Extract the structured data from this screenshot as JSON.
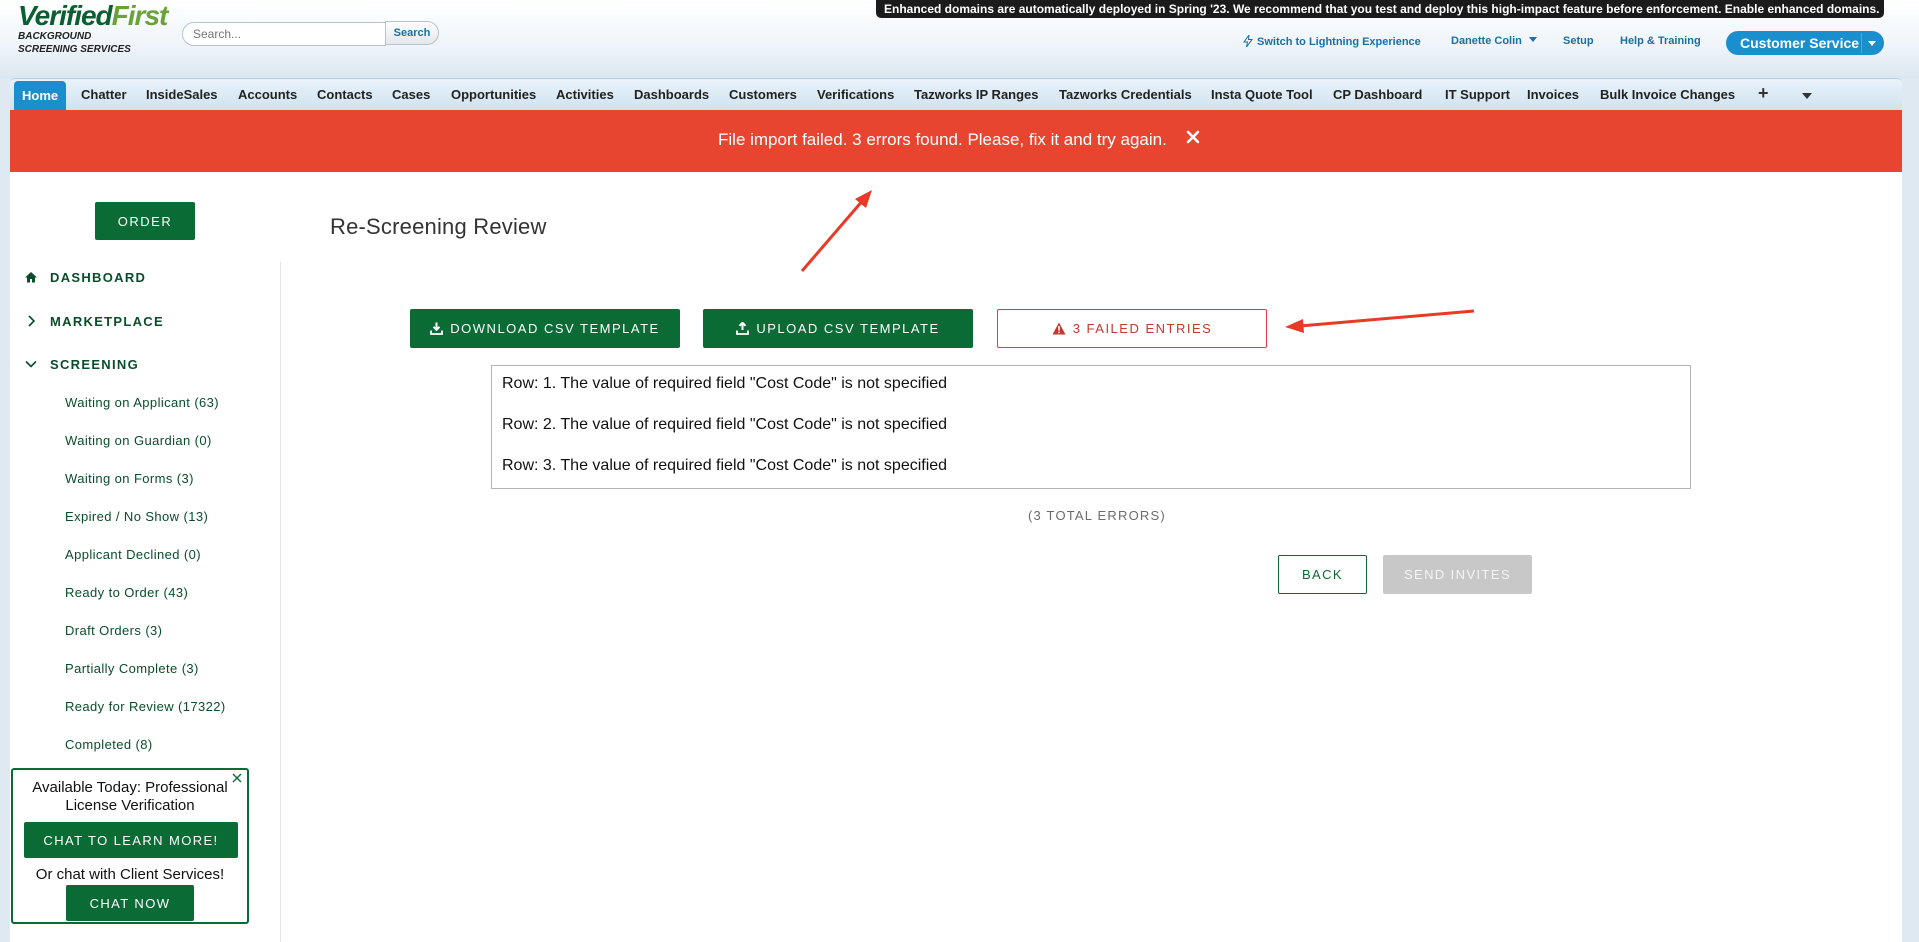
{
  "header": {
    "logo": {
      "line1a": "Verified",
      "line1b": "First",
      "line2": "BACKGROUND",
      "line3": "SCREENING SERVICES"
    },
    "search": {
      "placeholder": "Search...",
      "button": "Search"
    },
    "announcement": "Enhanced domains are automatically deployed in Spring '23. We recommend that you test and deploy this high-impact feature before enforcement. Enable enhanced domains.",
    "links": {
      "lightning": "Switch to Lightning Experience",
      "user": "Danette Colin",
      "setup": "Setup",
      "help": "Help & Training"
    },
    "app_switcher": "Customer Service"
  },
  "tabs": [
    "Home",
    "Chatter",
    "InsideSales",
    "Accounts",
    "Contacts",
    "Cases",
    "Opportunities",
    "Activities",
    "Dashboards",
    "Customers",
    "Verifications",
    "Tazworks IP Ranges",
    "Tazworks Credentials",
    "Insta Quote Tool",
    "CP Dashboard",
    "IT Support",
    "Invoices",
    "Bulk Invoice Changes"
  ],
  "tab_plus": "+",
  "banner": {
    "message": "File import failed. 3 errors found. Please, fix it and try again.",
    "close": "✕"
  },
  "sidebar": {
    "order_button": "ORDER",
    "dashboard": "DASHBOARD",
    "marketplace": "MARKETPLACE",
    "screening": "SCREENING",
    "items": [
      "Waiting on Applicant (63)",
      "Waiting on Guardian (0)",
      "Waiting on Forms (3)",
      "Expired / No Show (13)",
      "Applicant Declined (0)",
      "Ready to Order (43)",
      "Draft Orders (3)",
      "Partially Complete (3)",
      "Ready for Review (17322)",
      "Completed (8)"
    ]
  },
  "main": {
    "title": "Re-Screening Review",
    "download_btn": "DOWNLOAD CSV TEMPLATE",
    "upload_btn": "UPLOAD CSV TEMPLATE",
    "failed_btn": "3 FAILED ENTRIES",
    "errors": [
      "Row: 1. The value of required field \"Cost Code\" is not specified",
      "Row: 2. The value of required field \"Cost Code\" is not specified",
      "Row: 3. The value of required field \"Cost Code\" is not specified"
    ],
    "total_errors": "(3 TOTAL ERRORS)",
    "back_btn": "BACK",
    "send_btn": "SEND INVITES"
  },
  "chat": {
    "headline": "Available Today: Professional License Verification",
    "learn_btn": "CHAT TO LEARN MORE!",
    "or_text": "Or chat with Client Services!",
    "now_btn": "CHAT NOW",
    "close": "✕"
  },
  "colors": {
    "brand_green": "#0a6b35",
    "error_red": "#e84530",
    "link_blue": "#1b6fa6",
    "tab_active": "#1b8fce"
  }
}
